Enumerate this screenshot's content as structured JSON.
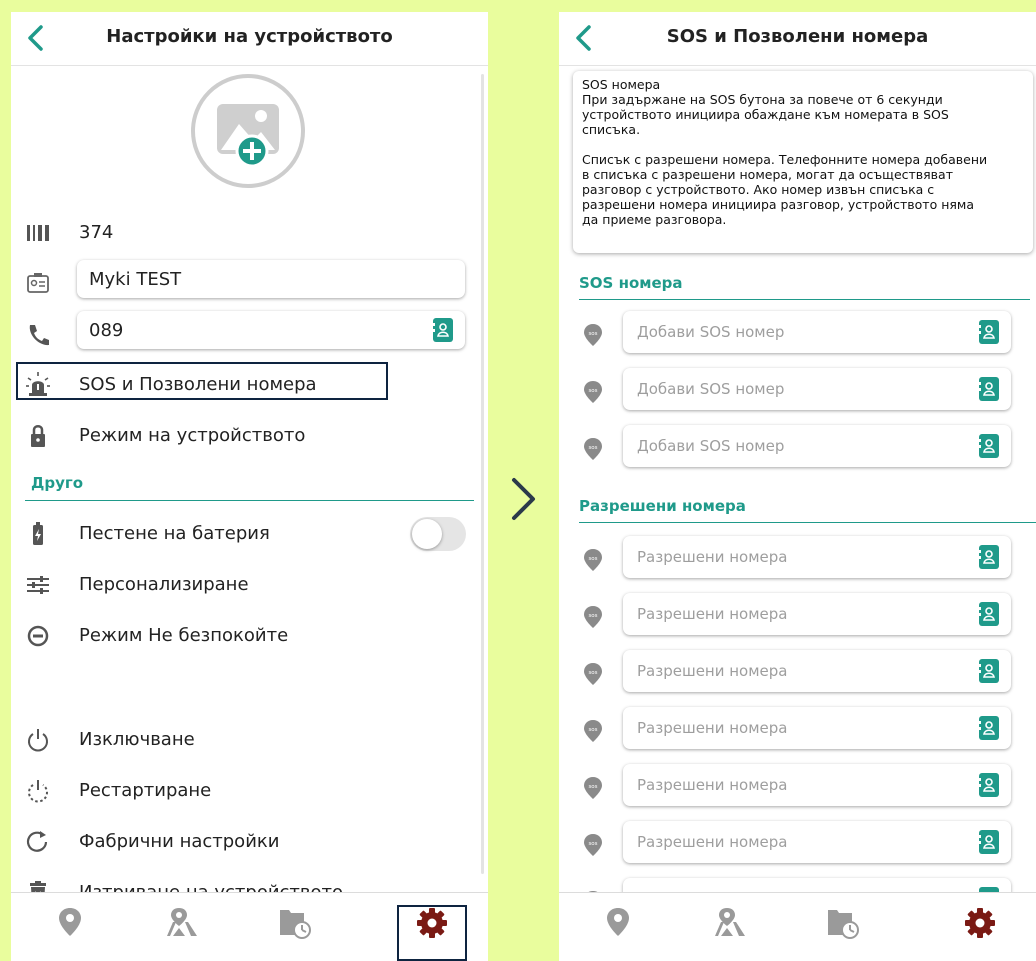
{
  "colors": {
    "accent": "#1f9a8a",
    "active_nav": "#7a1a14",
    "inactive_nav": "#9a9a9a",
    "background": "#e9fd9d",
    "highlight": "#0e2440"
  },
  "left": {
    "title": "Настройки на устройството",
    "device_id": "374",
    "name_value": "Myki TEST",
    "phone_value": "089",
    "menu": [
      {
        "label": "SOS и Позволени номера",
        "icon": "siren-icon"
      },
      {
        "label": "Режим на устройството",
        "icon": "lock-icon"
      }
    ],
    "other_section": "Друго",
    "other_items": [
      {
        "label": "Пестене на батерия",
        "icon": "battery-icon"
      },
      {
        "label": "Персонализиране",
        "icon": "sliders-icon"
      },
      {
        "label": "Режим Не безпокойте",
        "icon": "do-not-disturb-icon"
      }
    ],
    "power_items": [
      {
        "label": "Изключване",
        "icon": "power-icon"
      },
      {
        "label": "Рестартиране",
        "icon": "restart-icon"
      },
      {
        "label": "Фабрични настройки",
        "icon": "reset-icon"
      },
      {
        "label": "Изтриване на устройството",
        "icon": "trash-icon"
      }
    ],
    "battery_saving_on": false
  },
  "right": {
    "title": "SOS и Позволени номера",
    "info_p1_lines": [
      "SOS номера",
      "При задържане на SOS бутона за повече от 6 секунди",
      "устройството инициира обаждане към номерата в SOS",
      "списъка."
    ],
    "info_p2_lines": [
      "Списък с разрешени номера. Телефонните номера добавени",
      "в списъка с разрешени номера, могат да осъществяват",
      "разговор с устройството. Ако номер извън списъка с",
      "разрешени номера инициира разговор, устройството няма",
      "да приеме разговора."
    ],
    "sos_section": "SOS номера",
    "sos_placeholder": "Добави SOS номер",
    "allowed_section": "Разрешени номера",
    "allowed_placeholder": "Разрешени номера",
    "pin_label": "sos"
  },
  "nav": [
    "location-pin-icon",
    "map-icon",
    "history-icon",
    "settings-gear-icon"
  ]
}
